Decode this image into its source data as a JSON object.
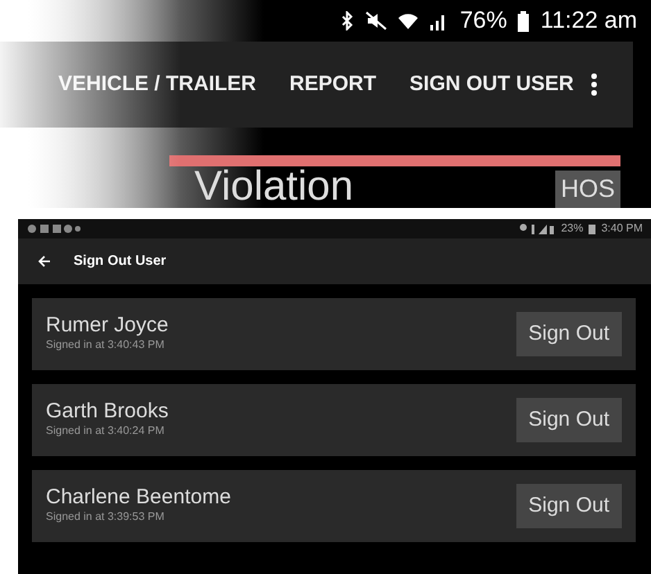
{
  "top_screen": {
    "status_bar": {
      "battery": "76%",
      "time": "11:22 am"
    },
    "app_bar": {
      "menu_items": [
        "VEHICLE / TRAILER",
        "REPORT",
        "SIGN OUT USER"
      ]
    },
    "content": {
      "title": "Violation",
      "tag": "HOS"
    }
  },
  "bottom_screen": {
    "status_bar": {
      "battery": "23%",
      "time": "3:40 PM"
    },
    "toolbar": {
      "title": "Sign Out User"
    },
    "users": [
      {
        "name": "Rumer Joyce",
        "signed_in": "Signed in at 3:40:43 PM",
        "button": "Sign Out"
      },
      {
        "name": "Garth Brooks",
        "signed_in": "Signed in at 3:40:24 PM",
        "button": "Sign Out"
      },
      {
        "name": "Charlene Beentome",
        "signed_in": "Signed in at 3:39:53 PM",
        "button": "Sign Out"
      }
    ]
  }
}
